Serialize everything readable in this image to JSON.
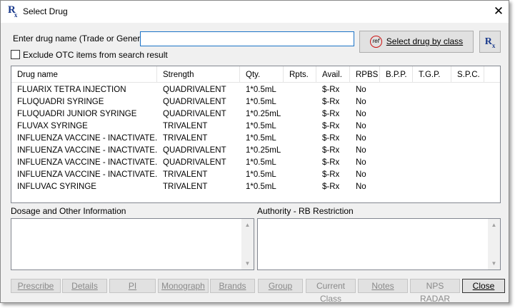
{
  "window": {
    "title": "Select Drug",
    "icon_glyph": "R",
    "icon_sub": "x"
  },
  "search": {
    "label": "Enter drug name (Trade or Generic )",
    "value": "",
    "exclude_otc_label": "Exclude OTC items from search result",
    "exclude_otc_checked": false,
    "by_class_label": "Select drug by class",
    "ref_icon_text": "ref",
    "rx_button_glyph": "R",
    "rx_button_sub": "x"
  },
  "table": {
    "columns": [
      "Drug name",
      "Strength",
      "Qty.",
      "Rpts.",
      "Avail.",
      "RPBS",
      "B.P.P.",
      "T.G.P.",
      "S.P.C."
    ],
    "rows": [
      {
        "name": "FLUARIX TETRA INJECTION",
        "strength": "QUADRIVALENT",
        "qty": "1*0.5mL",
        "rpts": "",
        "avail": "$-Rx",
        "rpbs": "No"
      },
      {
        "name": "FLUQUADRI SYRINGE",
        "strength": "QUADRIVALENT",
        "qty": "1*0.5mL",
        "rpts": "",
        "avail": "$-Rx",
        "rpbs": "No"
      },
      {
        "name": "FLUQUADRI JUNIOR SYRINGE",
        "strength": "QUADRIVALENT",
        "qty": "1*0.25mL",
        "rpts": "",
        "avail": "$-Rx",
        "rpbs": "No"
      },
      {
        "name": "FLUVAX SYRINGE",
        "strength": "TRIVALENT",
        "qty": "1*0.5mL",
        "rpts": "",
        "avail": "$-Rx",
        "rpbs": "No"
      },
      {
        "name": "INFLUENZA VACCINE - INACTIVATE...",
        "strength": "TRIVALENT",
        "qty": "1*0.5mL",
        "rpts": "",
        "avail": "$-Rx",
        "rpbs": "No"
      },
      {
        "name": "INFLUENZA VACCINE - INACTIVATE...",
        "strength": "QUADRIVALENT",
        "qty": "1*0.25mL",
        "rpts": "",
        "avail": "$-Rx",
        "rpbs": "No"
      },
      {
        "name": "INFLUENZA VACCINE - INACTIVATE...",
        "strength": "QUADRIVALENT",
        "qty": "1*0.5mL",
        "rpts": "",
        "avail": "$-Rx",
        "rpbs": "No"
      },
      {
        "name": "INFLUENZA VACCINE - INACTIVATE...",
        "strength": "TRIVALENT",
        "qty": "1*0.5mL",
        "rpts": "",
        "avail": "$-Rx",
        "rpbs": "No"
      },
      {
        "name": "INFLUVAC SYRINGE",
        "strength": "TRIVALENT",
        "qty": "1*0.5mL",
        "rpts": "",
        "avail": "$-Rx",
        "rpbs": "No"
      }
    ]
  },
  "sections": {
    "dosage_label": "Dosage and Other Information",
    "authority_label": "Authority - RB Restriction"
  },
  "buttons": {
    "prescribe": "Prescribe",
    "details": "Details",
    "pi": "PI",
    "monograph": "Monograph",
    "brands": "Brands",
    "group": "Group",
    "current_class": "Current Class",
    "notes": "Notes",
    "nps_radar": "NPS RADAR",
    "close": "Close"
  },
  "icons": {
    "close": "close-icon",
    "scroll_up": "scroll-up-arrow-icon",
    "scroll_down": "scroll-down-arrow-icon"
  },
  "colors": {
    "rx_blue": "#1a3a8c",
    "ref_red": "#cc1010",
    "focus_blue": "#1c73c7"
  }
}
